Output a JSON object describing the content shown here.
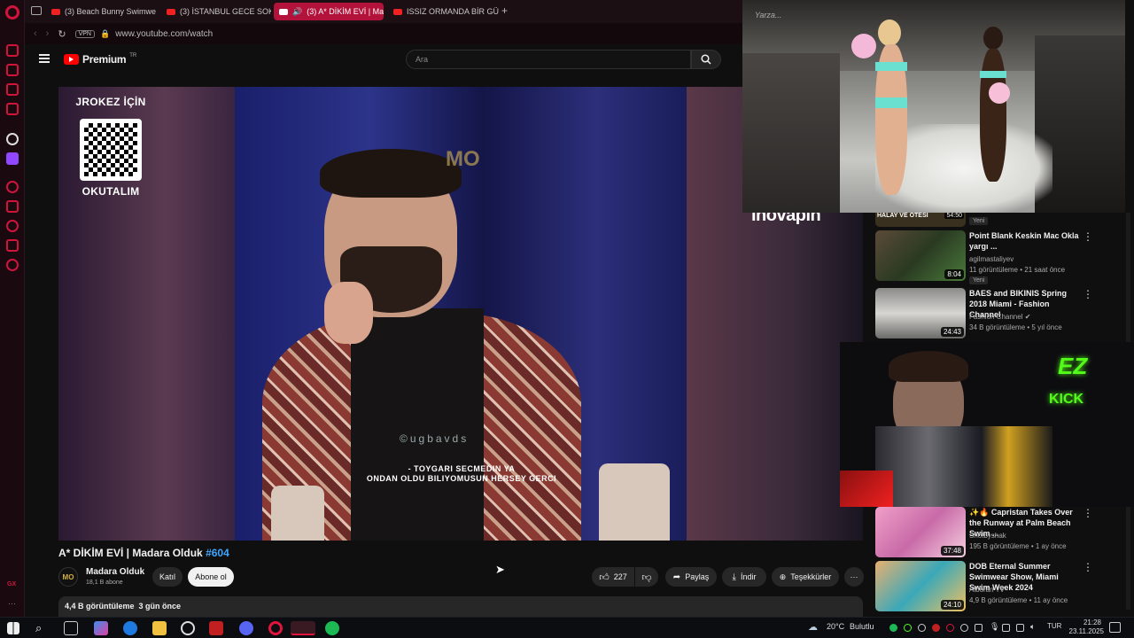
{
  "browser": {
    "tabs": [
      {
        "label": "(3) Beach Bunny Swimwe",
        "active": false
      },
      {
        "label": "(3) İSTANBUL GECE SOK",
        "active": false
      },
      {
        "label": "(3) A* DİKİM EVİ | Ma",
        "active": true
      },
      {
        "label": "ISSIZ ORMANDA BİR GÜN",
        "active": false
      }
    ],
    "vpn_label": "VPN",
    "url": "www.youtube.com/watch"
  },
  "youtube": {
    "logo_text": "Premium",
    "logo_region": "TR",
    "search_placeholder": "Ara"
  },
  "video": {
    "qr_top": "JROKEZ İÇİN",
    "qr_bottom": "OKUTALIM",
    "channel_mark": "MO",
    "watermark": "©ugbavds",
    "subtitle_line1": "- TOYGARI SECMEDIN YA",
    "subtitle_line2": "ONDAN OLDU BILIYOMUSUN HERSEY GERCI",
    "sponsor": "inovapin"
  },
  "watch": {
    "title": "A* DİKİM EVİ | Madara Olduk",
    "hashtag": "#604",
    "channel_name": "Madara Olduk",
    "subscribers": "18,1 B abone",
    "join_label": "Katıl",
    "subscribe_label": "Abone ol",
    "likes": "227",
    "share_label": "Paylaş",
    "download_label": "İndir",
    "thanks_label": "Teşekkürler",
    "views": "4,4 B görüntüleme",
    "age": "3 gün önce"
  },
  "recommendations": [
    {
      "title": "Point Blank Keskin Mac Okla yargı ...",
      "channel": "agilmastaliyev",
      "meta": "11 görüntüleme • 21 saat önce",
      "duration": "8:04",
      "badge": "Yeni"
    },
    {
      "title": "BAES and BIKINIS Spring 2018 Miami - Fashion Channel",
      "channel": "Fashion Channel",
      "meta": "34 B görüntüleme • 5 yıl önce",
      "duration": "24:43",
      "badge": ""
    },
    {
      "title": "✨🔥 Capristan Takes Over the Runway at Palm Beach Swim ...",
      "channel": "Shotbyshak",
      "meta": "195 B görüntüleme • 1 ay önce",
      "duration": "37:48",
      "badge": ""
    },
    {
      "title": "DOB Eternal Summer Swimwear Show, Miami Swim Week 2024",
      "channel": "Alborán TV",
      "meta": "4,9 B görüntüleme • 11 ay önce",
      "duration": "24:10",
      "badge": ""
    }
  ],
  "partial_rec": {
    "thumb_text": "HALAY VE ÖTESİ",
    "duration": "54:50",
    "badge": "Yeni"
  },
  "stream_overlay": {
    "badge_top": "EZ",
    "badge_bottom": "KICK"
  },
  "runway_overlay": {
    "watermark": "Yarza..."
  },
  "taskbar": {
    "weather_temp": "20°C",
    "weather_text": "Bulutlu",
    "language": "TUR",
    "time": "21:28",
    "date": "23.11.2025"
  },
  "colors": {
    "accent": "#d0143c",
    "yt_red": "#ff0000",
    "link_blue": "#3ea6ff",
    "kick_green": "#53fc18"
  }
}
